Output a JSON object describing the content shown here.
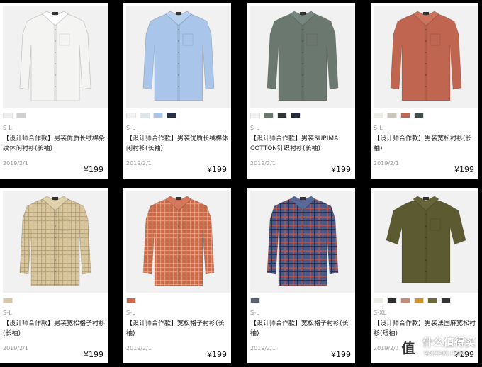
{
  "products": [
    {
      "name": "card-1",
      "shirt_color": "#f4f4f2",
      "collar_color": "#ffffff",
      "pattern": "plain",
      "colors": [
        "#eeeeee",
        "#cfcfcf"
      ],
      "size": "S-L",
      "title": "【设计师合作款】男装优质长绒棉条纹休闲衬衫(长袖)",
      "date": "2019/2/1",
      "price": "¥199"
    },
    {
      "name": "card-2",
      "shirt_color": "#a9c6ea",
      "collar_color": "#b7d0f0",
      "pattern": "plain",
      "colors": [
        "#f2f2f2",
        "#dfe6ea",
        "#a9c6ea",
        "#243048"
      ],
      "size": "S-L",
      "title": "【设计师合作款】男装优质长绒棉休闲衬衫(长袖)",
      "date": "2019/2/1",
      "price": "¥199"
    },
    {
      "name": "card-3",
      "shirt_color": "#6b7870",
      "collar_color": "#788680",
      "pattern": "plain",
      "colors": [
        "#f2f2f2",
        "#6b7870",
        "#2f3436",
        "#232a3a"
      ],
      "size": "S-L",
      "title": "【设计师合作款】男装SUPIMA COTTON针织衬衫(长袖)",
      "date": "2019/2/1",
      "price": "¥199"
    },
    {
      "name": "card-4",
      "shirt_color": "#c06550",
      "collar_color": "#cc735c",
      "pattern": "plain",
      "colors": [
        "#ecebe6",
        "#c9c6bd",
        "#c06550",
        "#3f4e4a"
      ],
      "size": "S-L",
      "title": "【设计师合作款】男装宽松衬衫(长袖)",
      "date": "2019/2/1",
      "price": "¥199"
    },
    {
      "name": "card-5",
      "shirt_color": "#d8c7a0",
      "collar_color": "#e1d2ae",
      "pattern": "check",
      "check_color": "#b49e72",
      "colors": [
        "#d8c7a0"
      ],
      "size": "S-L",
      "title": "【设计师合作款】男装宽松格子衬衫(长袖)",
      "date": "2019/2/1",
      "price": "¥199"
    },
    {
      "name": "card-6",
      "shirt_color": "#c9684c",
      "collar_color": "#d5775c",
      "pattern": "check",
      "check_color": "#e7a27a",
      "colors": [
        "#c9684c"
      ],
      "size": "S-L",
      "title": "【设计师合作款】宽松格子衬衫(长袖)",
      "date": "2019/2/1",
      "price": "¥199"
    },
    {
      "name": "card-7",
      "shirt_color": "#4a5a85",
      "collar_color": "#58699a",
      "pattern": "plaid",
      "check_color": "#b75450",
      "colors": [
        "#5a6270"
      ],
      "size": "S-L",
      "title": "【设计师合作款】宽松格子衬衫(长袖)",
      "date": "2019/2/1",
      "price": "¥199"
    },
    {
      "name": "card-8",
      "shirt_color": "#5b5a30",
      "collar_color": "#66653a",
      "pattern": "plain",
      "short": true,
      "colors": [
        "#ecebe6",
        "#2e2e2e",
        "#c48c7b",
        "#d2902a",
        "#6f6a3a",
        "#343434"
      ],
      "size": "S-XL",
      "title": "【设计师合作款】男装法国麻宽松衬衫(短袖)",
      "date": "2019/2/1",
      "price": "¥199"
    }
  ],
  "watermark": {
    "icon_char": "值",
    "text": "什么值得买",
    "sub": "SMZDM.COM"
  }
}
